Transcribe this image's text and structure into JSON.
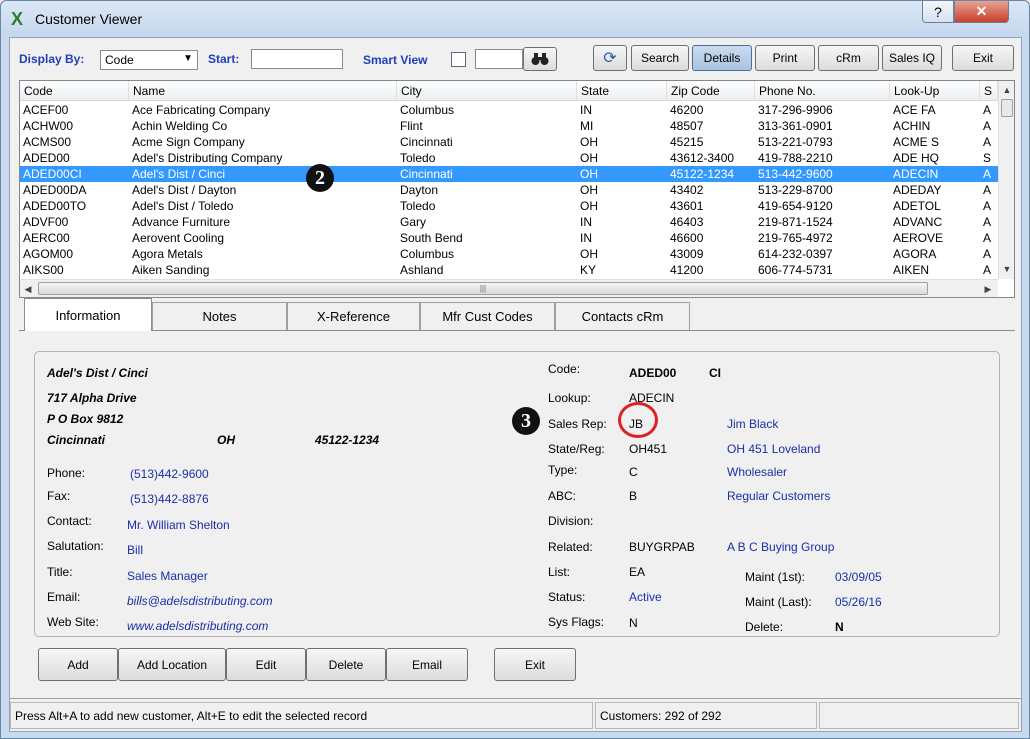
{
  "window": {
    "title": "Customer Viewer",
    "help_glyph": "?",
    "close_glyph": "✕",
    "app_glyph": "X"
  },
  "toolbar": {
    "display_by_label": "Display By:",
    "display_by_value": "Code",
    "start_label": "Start:",
    "start_value": "",
    "smart_view_label": "Smart View",
    "smart_view_value": "",
    "buttons": {
      "refresh": "⟳",
      "search": "Search",
      "details": "Details",
      "print": "Print",
      "crm": "cRm",
      "sales_iq": "Sales IQ",
      "exit": "Exit"
    }
  },
  "grid": {
    "columns": [
      "Code",
      "Name",
      "City",
      "State",
      "Zip Code",
      "Phone No.",
      "Look-Up",
      "S"
    ],
    "rows": [
      {
        "code": "ACEF00",
        "name": "Ace Fabricating Company",
        "city": "Columbus",
        "state": "IN",
        "zip": "46200",
        "phone": "317-296-9906",
        "lookup": "ACE FA",
        "s": "A"
      },
      {
        "code": "ACHW00",
        "name": "Achin Welding Co",
        "city": "Flint",
        "state": "MI",
        "zip": "48507",
        "phone": "313-361-0901",
        "lookup": "ACHIN",
        "s": "A"
      },
      {
        "code": "ACMS00",
        "name": "Acme Sign Company",
        "city": "Cincinnati",
        "state": "OH",
        "zip": "45215",
        "phone": "513-221-0793",
        "lookup": "ACME S",
        "s": "A"
      },
      {
        "code": "ADED00",
        "name": "Adel's Distributing Company",
        "city": "Toledo",
        "state": "OH",
        "zip": "43612-3400",
        "phone": "419-788-2210",
        "lookup": "ADE HQ",
        "s": "S"
      },
      {
        "code": "ADED00CI",
        "name": "Adel's Dist / Cinci",
        "city": "Cincinnati",
        "state": "OH",
        "zip": "45122-1234",
        "phone": "513-442-9600",
        "lookup": "ADECIN",
        "s": "A",
        "selected": true
      },
      {
        "code": "ADED00DA",
        "name": "Adel's Dist / Dayton",
        "city": "Dayton",
        "state": "OH",
        "zip": "43402",
        "phone": "513-229-8700",
        "lookup": "ADEDAY",
        "s": "A"
      },
      {
        "code": "ADED00TO",
        "name": "Adel's Dist / Toledo",
        "city": "Toledo",
        "state": "OH",
        "zip": "43601",
        "phone": "419-654-9120",
        "lookup": "ADETOL",
        "s": "A"
      },
      {
        "code": "ADVF00",
        "name": "Advance Furniture",
        "city": "Gary",
        "state": "IN",
        "zip": "46403",
        "phone": "219-871-1524",
        "lookup": "ADVANC",
        "s": "A"
      },
      {
        "code": "AERC00",
        "name": "Aerovent Cooling",
        "city": "South Bend",
        "state": "IN",
        "zip": "46600",
        "phone": "219-765-4972",
        "lookup": "AEROVE",
        "s": "A"
      },
      {
        "code": "AGOM00",
        "name": "Agora Metals",
        "city": "Columbus",
        "state": "OH",
        "zip": "43009",
        "phone": "614-232-0397",
        "lookup": "AGORA",
        "s": "A"
      },
      {
        "code": "AIKS00",
        "name": "Aiken Sanding",
        "city": "Ashland",
        "state": "KY",
        "zip": "41200",
        "phone": "606-774-5731",
        "lookup": "AIKEN",
        "s": "A"
      }
    ]
  },
  "badges": {
    "row": "2",
    "sales_rep": "3"
  },
  "tabs": [
    "Information",
    "Notes",
    "X-Reference",
    "Mfr Cust Codes",
    "Contacts cRm"
  ],
  "info": {
    "name": "Adel's Dist / Cinci",
    "address1": "717 Alpha Drive",
    "address2": "P O Box 9812",
    "city": "Cincinnati",
    "state": "OH",
    "zip": "45122-1234",
    "phone_label": "Phone:",
    "phone": "(513)442-9600",
    "fax_label": "Fax:",
    "fax": "(513)442-8876",
    "contact_label": "Contact:",
    "contact": "Mr. William Shelton",
    "salutation_label": "Salutation:",
    "salutation": "Bill",
    "title_label": "Title:",
    "title": "Sales Manager",
    "email_label": "Email:",
    "email": "bills@adelsdistributing.com",
    "website_label": "Web Site:",
    "website": "www.adelsdistributing.com",
    "code_label": "Code:",
    "code": "ADED00",
    "code_suffix": "CI",
    "lookup_label": "Lookup:",
    "lookup": "ADECIN",
    "sales_rep_label": "Sales Rep:",
    "sales_rep": "JB",
    "sales_rep_name": "Jim Black",
    "state_reg_label": "State/Reg:",
    "state_reg": "OH451",
    "state_reg_name": "OH 451 Loveland",
    "type_label": "Type:",
    "type": "C",
    "type_name": "Wholesaler",
    "abc_label": "ABC:",
    "abc": "B",
    "abc_name": "Regular Customers",
    "division_label": "Division:",
    "related_label": "Related:",
    "related": "BUYGRPAB",
    "related_name": "A B C Buying Group",
    "list_label": "List:",
    "list": "EA",
    "status_label": "Status:",
    "status": "Active",
    "sys_flags_label": "Sys Flags:",
    "sys_flags": "N",
    "maint_first_label": "Maint (1st):",
    "maint_first": "03/09/05",
    "maint_last_label": "Maint (Last):",
    "maint_last": "05/26/16",
    "delete_label": "Delete:",
    "delete": "N"
  },
  "actions": {
    "add": "Add",
    "add_location": "Add Location",
    "edit": "Edit",
    "delete": "Delete",
    "email": "Email",
    "exit": "Exit"
  },
  "status": {
    "hint": "Press Alt+A to add new customer,  Alt+E to edit the selected record",
    "count": "Customers: 292 of 292"
  }
}
